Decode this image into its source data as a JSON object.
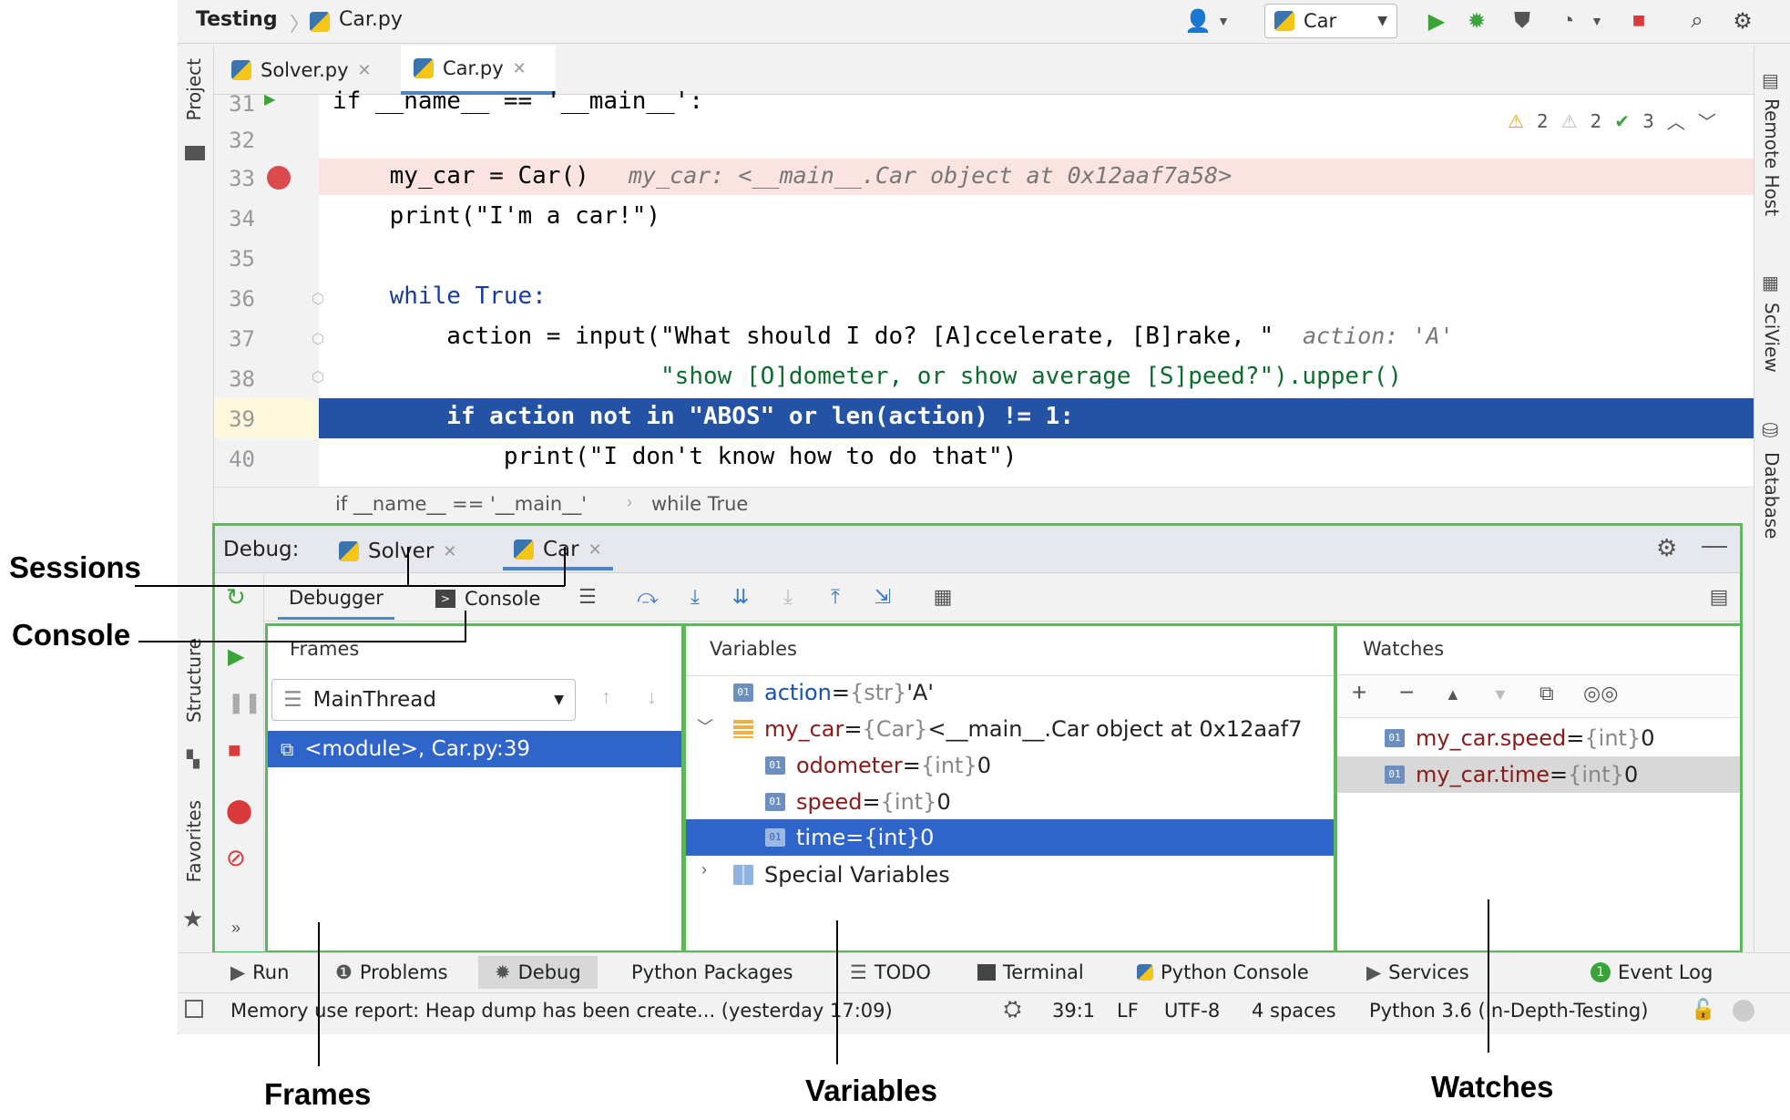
{
  "breadcrumb": {
    "project": "Testing",
    "file": "Car.py"
  },
  "toolbar": {
    "run_config": "Car"
  },
  "editor_tabs": [
    {
      "label": "Solver.py",
      "active": false
    },
    {
      "label": "Car.py",
      "active": true
    }
  ],
  "left_tool_labels": {
    "project": "Project",
    "structure": "Structure",
    "favorites": "Favorites"
  },
  "right_tool_labels": {
    "remote_host": "Remote Host",
    "sciview": "SciView",
    "database": "Database"
  },
  "inspections": {
    "warnings_a": "2",
    "warnings_b": "2",
    "ok": "3"
  },
  "code_lines": [
    {
      "num": "31",
      "text": "if __name__ == '__main__':"
    },
    {
      "num": "32",
      "text": ""
    },
    {
      "num": "33",
      "text": "    my_car = Car()",
      "inline": "my_car: <__main__.Car object at 0x12aaf7a58>"
    },
    {
      "num": "34",
      "text": "    print(\"I'm a car!\")"
    },
    {
      "num": "35",
      "text": ""
    },
    {
      "num": "36",
      "text": "    while True:"
    },
    {
      "num": "37",
      "text": "        action = input(\"What should I do? [A]ccelerate, [B]rake, \"",
      "inline": "action: 'A'"
    },
    {
      "num": "38",
      "text": "                       \"show [O]dometer, or show average [S]peed?\").upper()"
    },
    {
      "num": "39",
      "text": "        if action not in \"ABOS\" or len(action) != 1:"
    },
    {
      "num": "40",
      "text": "            print(\"I don't know how to do that\")"
    }
  ],
  "code_breadcrumb": {
    "a": "if __name__ == '__main__'",
    "b": "while True"
  },
  "debug": {
    "label": "Debug:",
    "sessions": [
      {
        "label": "Solver",
        "active": false
      },
      {
        "label": "Car",
        "active": true
      }
    ],
    "subtabs": {
      "debugger": "Debugger",
      "console": "Console"
    }
  },
  "frames": {
    "title": "Frames",
    "thread": "MainThread",
    "items": [
      "<module>, Car.py:39"
    ]
  },
  "variables": {
    "title": "Variables",
    "rows": [
      {
        "name": "action",
        "eq": " = ",
        "type": "{str}",
        "value": " 'A'"
      },
      {
        "name": "my_car",
        "eq": " = ",
        "type": "{Car}",
        "value": " <__main__.Car object at 0x12aaf7"
      },
      {
        "name": "odometer",
        "eq": " = ",
        "type": "{int}",
        "value": " 0"
      },
      {
        "name": "speed",
        "eq": " = ",
        "type": "{int}",
        "value": " 0"
      },
      {
        "name": "time",
        "eq": " = ",
        "type": "{int}",
        "value": " 0"
      },
      {
        "name": "Special Variables"
      }
    ]
  },
  "watches": {
    "title": "Watches",
    "rows": [
      {
        "name": "my_car.speed",
        "eq": " = ",
        "type": "{int}",
        "value": " 0"
      },
      {
        "name": "my_car.time",
        "eq": " = ",
        "type": "{int}",
        "value": " 0"
      }
    ]
  },
  "bottom_tabs": [
    "Run",
    "Problems",
    "Debug",
    "Python Packages",
    "TODO",
    "Terminal",
    "Python Console",
    "Services",
    "Event Log"
  ],
  "event_log_count": "1",
  "status": {
    "message": "Memory use report: Heap dump has been create... (yesterday 17:09)",
    "position": "39:1",
    "line_sep": "LF",
    "encoding": "UTF-8",
    "indent": "4 spaces",
    "interpreter": "Python 3.6 (In-Depth-Testing)"
  },
  "callouts": {
    "sessions": "Sessions",
    "console": "Console",
    "frames": "Frames",
    "variables": "Variables",
    "watches": "Watches"
  },
  "colors": {
    "accent": "#2f65ca",
    "highlight_line": "#2452a5",
    "pane_border": "#5cb85c",
    "breakpoint": "#db4b4b"
  }
}
